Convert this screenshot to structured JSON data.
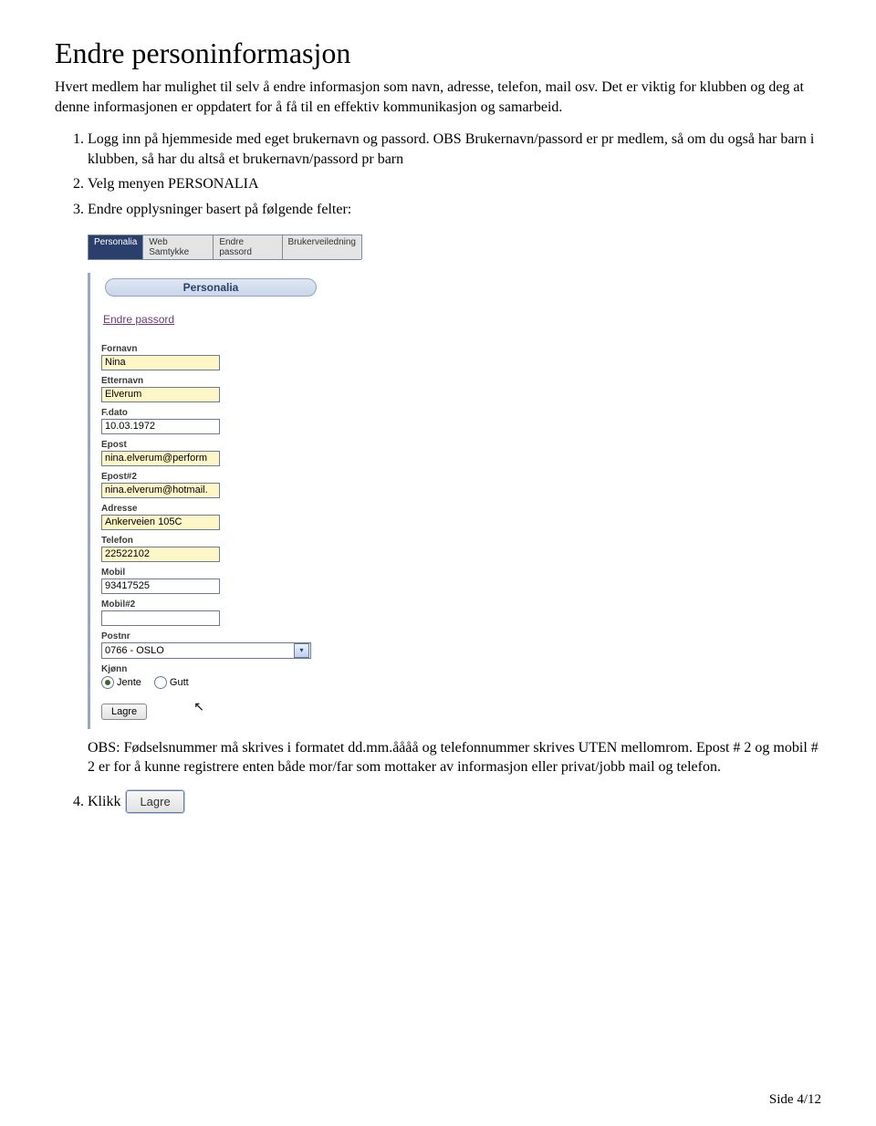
{
  "title": "Endre personinformasjon",
  "intro": "Hvert medlem har mulighet til selv å endre informasjon som navn, adresse, telefon, mail osv. Det er viktig for klubben og deg at denne informasjonen er oppdatert for å få til en effektiv kommunikasjon og samarbeid.",
  "steps": {
    "s1": "Logg inn på hjemmeside med eget brukernavn og passord. OBS Brukernavn/passord er pr medlem, så om du også har barn i klubben, så har du altså et brukernavn/passord pr barn",
    "s2": "Velg menyen PERSONALIA",
    "s3": "Endre opplysninger basert på følgende felter:",
    "s4": "Klikk"
  },
  "form": {
    "tabs": [
      "Personalia",
      "Web Samtykke",
      "Endre passord",
      "Brukerveiledning"
    ],
    "section_title": "Personalia",
    "pw_link": "Endre passord",
    "fields": {
      "fornavn": {
        "label": "Fornavn",
        "value": "Nina"
      },
      "etternavn": {
        "label": "Etternavn",
        "value": "Elverum"
      },
      "fdato": {
        "label": "F.dato",
        "value": "10.03.1972"
      },
      "epost": {
        "label": "Epost",
        "value": "nina.elverum@perform"
      },
      "epost2": {
        "label": "Epost#2",
        "value": "nina.elverum@hotmail."
      },
      "adresse": {
        "label": "Adresse",
        "value": "Ankerveien 105C"
      },
      "telefon": {
        "label": "Telefon",
        "value": "22522102"
      },
      "mobil": {
        "label": "Mobil",
        "value": "93417525"
      },
      "mobil2": {
        "label": "Mobil#2",
        "value": ""
      },
      "postnr": {
        "label": "Postnr",
        "value": "0766 - OSLO"
      },
      "kjonn": {
        "label": "Kjønn",
        "jente": "Jente",
        "gutt": "Gutt"
      }
    },
    "save": "Lagre"
  },
  "obs_note": "OBS: Fødselsnummer må skrives i formatet dd.mm.åååå og telefonnummer skrives UTEN mellomrom. Epost # 2 og mobil # 2 er for å kunne registrere enten både mor/far som mottaker av informasjon eller privat/jobb mail og telefon.",
  "save_inline": "Lagre",
  "footer": "Side 4/12"
}
